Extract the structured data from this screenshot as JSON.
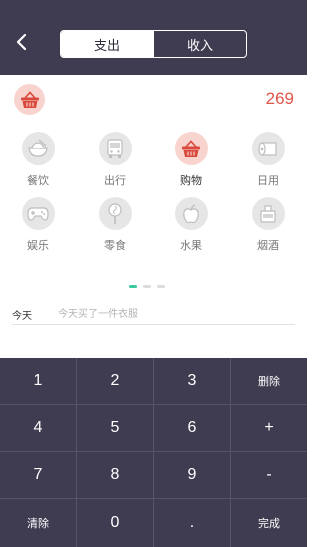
{
  "header": {
    "tabs": [
      {
        "label": "支出",
        "active": true
      },
      {
        "label": "收入",
        "active": false
      }
    ]
  },
  "entry": {
    "selected_category_icon": "shopping-basket-icon",
    "amount": "269"
  },
  "categories": [
    {
      "label": "餐饮",
      "icon": "rice-bowl-icon"
    },
    {
      "label": "出行",
      "icon": "bus-icon"
    },
    {
      "label": "购物",
      "icon": "shopping-basket-icon",
      "selected": true
    },
    {
      "label": "日用",
      "icon": "tissue-roll-icon"
    },
    {
      "label": "娱乐",
      "icon": "gamepad-icon"
    },
    {
      "label": "零食",
      "icon": "lollipop-icon"
    },
    {
      "label": "水果",
      "icon": "apple-icon"
    },
    {
      "label": "烟酒",
      "icon": "wine-bottle-icon"
    }
  ],
  "pager": {
    "pages": 3,
    "current": 1
  },
  "note": {
    "date_label": "今天",
    "placeholder": "今天买了一件衣服"
  },
  "keypad": {
    "keys": [
      "1",
      "2",
      "3",
      "删除",
      "4",
      "5",
      "6",
      "+",
      "7",
      "8",
      "9",
      "-",
      "清除",
      "0",
      ".",
      "完成"
    ]
  },
  "colors": {
    "header_bg": "#3f3c52",
    "accent_red": "#e0554a",
    "selected_bg": "#f9d4cf",
    "pager_active": "#3cc8a2"
  }
}
